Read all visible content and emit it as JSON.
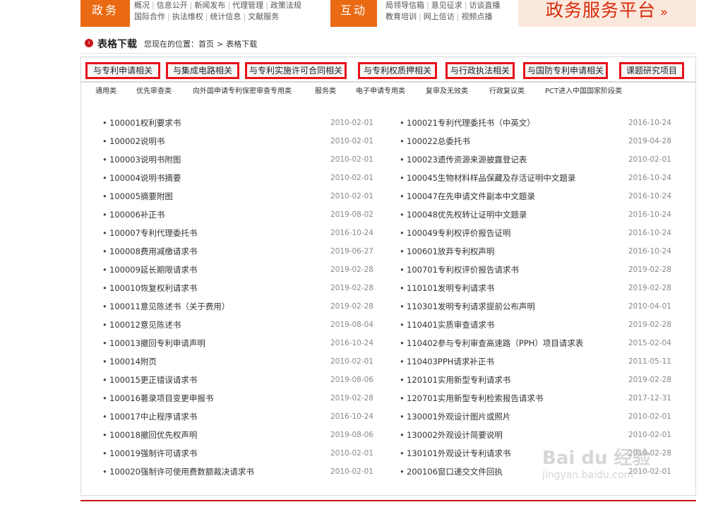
{
  "topnav": {
    "gov_label": "政务",
    "gov_links_row1": [
      "概况",
      "信息公开",
      "新闻发布",
      "代理管理",
      "政策法规"
    ],
    "gov_links_row2": [
      "国际合作",
      "执法维权",
      "统计信息",
      "文献服务"
    ],
    "interact_label": "互动",
    "interact_links_row1": [
      "局领导信箱",
      "意见征求",
      "访谈直播"
    ],
    "interact_links_row2": [
      "教育培训",
      "网上信访",
      "视频点播"
    ],
    "service_platform": "政务服务平台",
    "service_arrow": "»"
  },
  "breadcrumb": {
    "title": "表格下载",
    "location_prefix": "您现在的位置：",
    "home": "首页",
    "separator": ">",
    "current": "表格下载"
  },
  "tabs": [
    "与专利申请相关",
    "与集成电路相关",
    "与专利实施许可合同相关",
    "与专利权质押相关",
    "与行政执法相关",
    "与国防专利申请相关",
    "课题研究项目"
  ],
  "subcategories": [
    "通用类",
    "优先审查类",
    "向外国申请专利保密审查专用类",
    "服务类",
    "电子申请专用类",
    "复审及无效类",
    "行政复议类",
    "PCT进入中国国家阶段类"
  ],
  "left_list": [
    {
      "name": "100001权利要求书",
      "date": "2010-02-01"
    },
    {
      "name": "100002说明书",
      "date": "2010-02-01"
    },
    {
      "name": "100003说明书附图",
      "date": "2010-02-01"
    },
    {
      "name": "100004说明书摘要",
      "date": "2010-02-01"
    },
    {
      "name": "100005摘要附图",
      "date": "2010-02-01"
    },
    {
      "name": "100006补正书",
      "date": "2019-08-02"
    },
    {
      "name": "100007专利代理委托书",
      "date": "2016-10-24"
    },
    {
      "name": "100008费用减缴请求书",
      "date": "2019-06-27"
    },
    {
      "name": "100009延长期限请求书",
      "date": "2019-02-28"
    },
    {
      "name": "100010恢复权利请求书",
      "date": "2019-02-28"
    },
    {
      "name": "100011意见陈述书（关于费用）",
      "date": "2019-02-28"
    },
    {
      "name": "100012意见陈述书",
      "date": "2019-08-04"
    },
    {
      "name": "100013撤回专利申请声明",
      "date": "2016-10-24"
    },
    {
      "name": "100014附页",
      "date": "2010-02-01"
    },
    {
      "name": "100015更正错误请求书",
      "date": "2019-08-06"
    },
    {
      "name": "100016著录项目变更申报书",
      "date": "2019-02-28"
    },
    {
      "name": "100017中止程序请求书",
      "date": "2016-10-24"
    },
    {
      "name": "100018撤回优先权声明",
      "date": "2019-08-06"
    },
    {
      "name": "100019强制许可请求书",
      "date": "2010-02-01"
    },
    {
      "name": "100020强制许可使用费数额裁决请求书",
      "date": "2010-02-01"
    }
  ],
  "right_list": [
    {
      "name": "100021专利代理委托书（中英文）",
      "date": "2016-10-24"
    },
    {
      "name": "100022总委托书",
      "date": "2019-04-28"
    },
    {
      "name": "100023遗传资源来源披露登记表",
      "date": "2010-02-01"
    },
    {
      "name": "100045生物材料样品保藏及存活证明中文题录",
      "date": "2016-10-24"
    },
    {
      "name": "100047在先申请文件副本中文题录",
      "date": "2016-10-24"
    },
    {
      "name": "100048优先权转让证明中文题录",
      "date": "2016-10-24"
    },
    {
      "name": "100049专利权评价报告证明",
      "date": "2016-10-24"
    },
    {
      "name": "100601放弃专利权声明",
      "date": "2016-10-24"
    },
    {
      "name": "100701专利权评价报告请求书",
      "date": "2019-02-28"
    },
    {
      "name": "110101发明专利请求书",
      "date": "2019-02-28"
    },
    {
      "name": "110301发明专利请求提前公布声明",
      "date": "2010-04-01"
    },
    {
      "name": "110401实质审查请求书",
      "date": "2019-02-28"
    },
    {
      "name": "110402参与专利审查高速路（PPH）项目请求表",
      "date": "2015-02-04"
    },
    {
      "name": "110403PPH请求补正书",
      "date": "2011-05-11"
    },
    {
      "name": "120101实用新型专利请求书",
      "date": "2019-02-28"
    },
    {
      "name": "120701实用新型专利检索报告请求书",
      "date": "2017-12-31"
    },
    {
      "name": "130001外观设计图片或照片",
      "date": "2010-02-01"
    },
    {
      "name": "130002外观设计简要说明",
      "date": "2010-02-01"
    },
    {
      "name": "130101外观设计专利请求书",
      "date": "2019-02-28"
    },
    {
      "name": "200106窗口递交文件回执",
      "date": "2010-02-01"
    }
  ],
  "watermark": {
    "main": "Bai du 经验",
    "sub": "jingyan.baidu.com"
  }
}
